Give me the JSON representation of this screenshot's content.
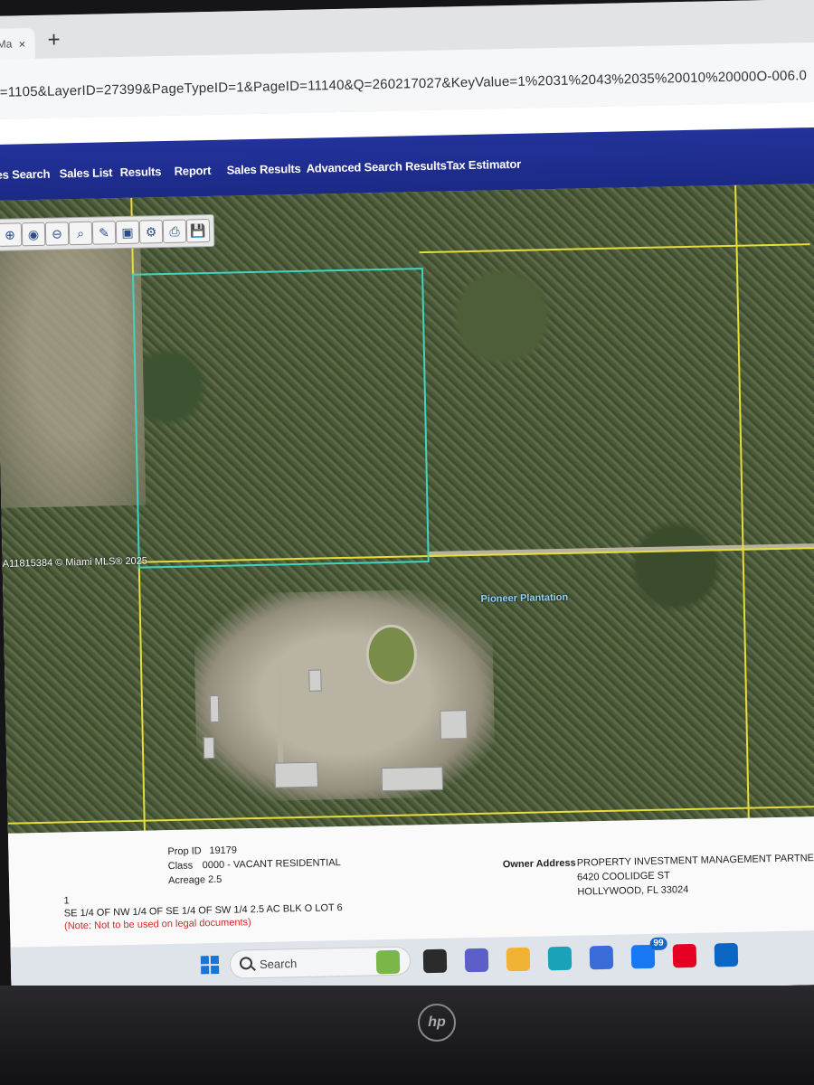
{
  "browser": {
    "tab_label": "Ma",
    "tab_close": "×",
    "new_tab": "+",
    "url": "=1105&LayerID=27399&PageTypeID=1&PageID=11140&Q=260217027&KeyValue=1%2031%2043%2035%20010%20000O-006.0"
  },
  "nav": {
    "items": [
      "es Search",
      "Sales List",
      "Results",
      "Report",
      "Sales Results",
      "Advanced Search Results",
      "Tax Estimator"
    ]
  },
  "map": {
    "watermark": "A11815384 © Miami MLS® 2025",
    "place_label": "Pioneer Plantation",
    "tools": [
      "zoom-in-icon",
      "camera-icon",
      "zoom-out-icon",
      "magnifier-icon",
      "pencil-icon",
      "select-icon",
      "identify-icon",
      "print-icon",
      "save-icon"
    ],
    "tool_glyphs": [
      "⊕",
      "◉",
      "⊖",
      "⌕",
      "✎",
      "▣",
      "⚙",
      "⎙",
      "💾"
    ],
    "parcel_color": "#3fd3c0",
    "line_color": "#e6dc3a"
  },
  "parcel": {
    "prop_id_label": "Prop ID",
    "prop_id": "19179",
    "class_label": "Class",
    "class_value": "0000 - VACANT RESIDENTIAL",
    "acreage_label": "Acreage",
    "acreage_value": "2.5",
    "index": "1",
    "legal": "SE 1/4 OF NW 1/4 OF SE 1/4 OF SW 1/4 2.5 AC BLK O LOT 6",
    "note": "(Note: Not to be used on legal documents)",
    "owner_label": "Owner Address",
    "owner_name": "PROPERTY INVESTMENT MANAGEMENT PARTNERS L",
    "owner_street": "6420 COOLIDGE ST",
    "owner_city": "HOLLYWOOD, FL 33024"
  },
  "taskbar": {
    "search_placeholder": "Search",
    "badge_count": "99"
  },
  "monitor": {
    "brand": "hp"
  }
}
